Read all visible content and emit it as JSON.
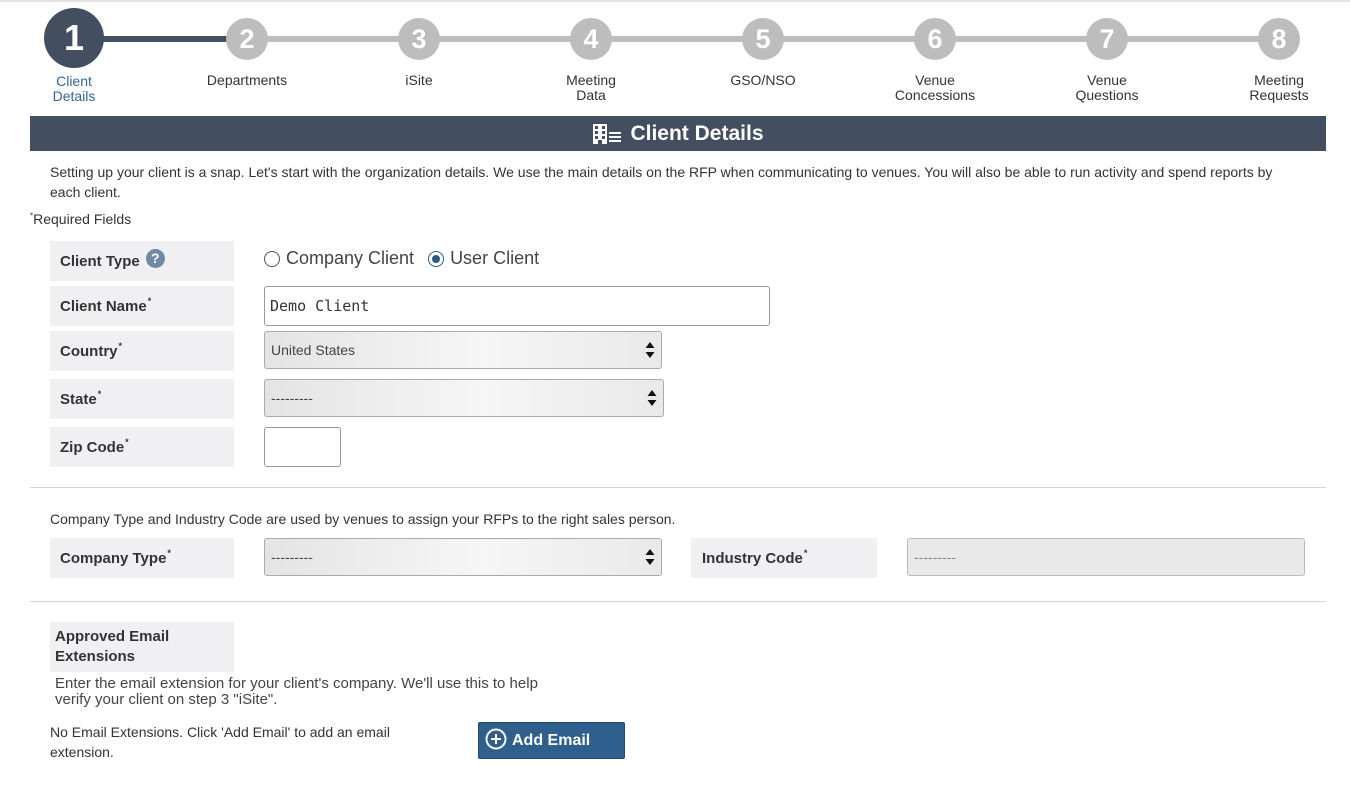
{
  "stepper": {
    "steps": [
      {
        "number": "1",
        "label": "Client Details",
        "active": true
      },
      {
        "number": "2",
        "label": "Departments"
      },
      {
        "number": "3",
        "label": "iSite"
      },
      {
        "number": "4",
        "label": "Meeting Data"
      },
      {
        "number": "5",
        "label": "GSO/NSO"
      },
      {
        "number": "6",
        "label": "Venue Concessions"
      },
      {
        "number": "7",
        "label": "Venue Questions"
      },
      {
        "number": "8",
        "label": "Meeting Requests"
      }
    ]
  },
  "header": {
    "title": "Client Details",
    "icon": "building-list-icon"
  },
  "intro": "Setting up your client is a snap. Let's start with the organization details. We use the main details on the RFP when communicating to venues. You will also be able to run activity and spend reports by each client.",
  "required_note": {
    "marker": "*",
    "text": "Required Fields"
  },
  "form": {
    "client_type": {
      "label": "Client Type",
      "help": "?",
      "options": [
        "Company Client",
        "User Client"
      ],
      "selected": "User Client"
    },
    "client_name": {
      "label": "Client Name",
      "required": "*",
      "value": "Demo Client"
    },
    "country": {
      "label": "Country",
      "required": "*",
      "value": "United States"
    },
    "state": {
      "label": "State",
      "required": "*",
      "value": "---------"
    },
    "zip": {
      "label": "Zip Code",
      "required": "*",
      "value": ""
    }
  },
  "company_section": {
    "note": "Company Type and Industry Code are used by venues to assign your RFPs to the right sales person.",
    "company_type": {
      "label": "Company Type",
      "required": "*",
      "value": "---------"
    },
    "industry_code": {
      "label": "Industry Code",
      "required": "*",
      "value": "---------"
    }
  },
  "email_section": {
    "label": "Approved Email Extensions",
    "help_text": "Enter the email extension for your client's company. We'll use this to help verify your client on step 3 \"iSite\".",
    "empty_text": "No Email Extensions. Click 'Add Email' to add an email extension.",
    "add_button": "Add Email"
  },
  "colors": {
    "primary_dark": "#434f60",
    "step_inactive": "#bdbdbd",
    "active_label": "#336699",
    "button": "#2f5f8d",
    "label_bg": "#f0f0f2"
  }
}
